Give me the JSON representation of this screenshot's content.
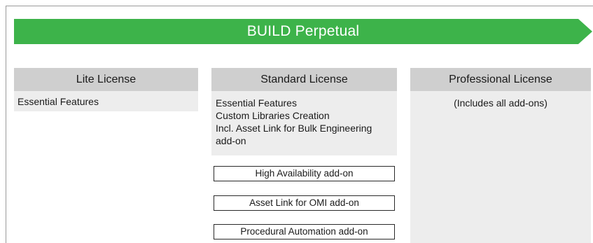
{
  "banner": {
    "title": "BUILD Perpetual",
    "color": "#3db34a"
  },
  "columns": [
    {
      "header": "Lite License",
      "features": [
        "Essential Features"
      ]
    },
    {
      "header": "Standard License",
      "features": [
        "Essential Features",
        "Custom Libraries Creation",
        "Incl. Asset Link for Bulk Engineering",
        "add-on"
      ],
      "addons": [
        "High Availability add-on",
        "Asset Link for OMI add-on",
        "Procedural Automation add-on"
      ]
    },
    {
      "header": "Professional License",
      "features": [
        "(Includes all add-ons)"
      ]
    }
  ]
}
